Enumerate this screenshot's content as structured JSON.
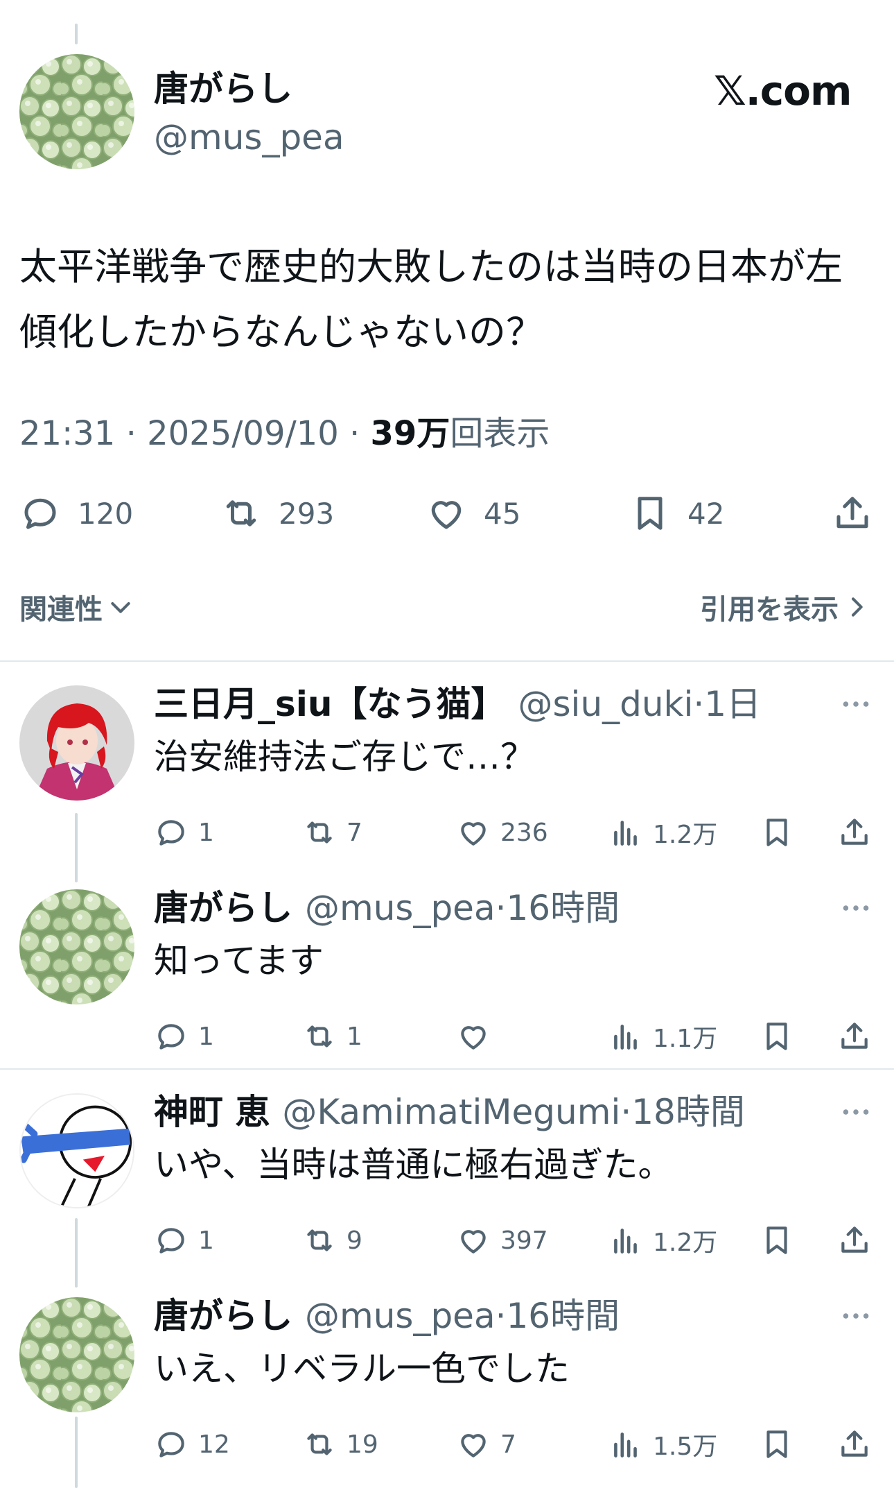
{
  "main": {
    "name": "唐がらし",
    "handle": "@mus_pea",
    "logo": "𝕏.com",
    "text": "太平洋戦争で歴史的大敗したのは当時の日本が左傾化したからなんじゃないの？",
    "time": "21:31 · 2025/09/10 · ",
    "views_num": "39万",
    "views_label": "回表示",
    "replies": "120",
    "retweets": "293",
    "likes": "45",
    "bookmarks": "42",
    "related_label": "関連性",
    "quotes_label": "引用を表示"
  },
  "replies": [
    {
      "name": "三日月_siu【なう猫】",
      "handle": "@siu_duki·1日",
      "text": "治安維持法ご存じで…？",
      "replies": "1",
      "retweets": "7",
      "likes": "236",
      "views": "1.2万"
    },
    {
      "name": "唐がらし",
      "handle": "@mus_pea·16時間",
      "text": "知ってます",
      "replies": "1",
      "retweets": "1",
      "likes": "",
      "views": "1.1万"
    },
    {
      "name": "神町 恵",
      "handle": "@KamimatiMegumi·18時間",
      "text": "いや、当時は普通に極右過ぎた。",
      "replies": "1",
      "retweets": "9",
      "likes": "397",
      "views": "1.2万"
    },
    {
      "name": "唐がらし",
      "handle": "@mus_pea·16時間",
      "text": "いえ、リベラル一色でした",
      "replies": "12",
      "retweets": "19",
      "likes": "7",
      "views": "1.5万"
    }
  ],
  "colors": {
    "text": "#0f1419",
    "secondary": "#536471",
    "divider": "#e1e8ed",
    "thread": "#cfd9de"
  },
  "icons": [
    "reply-icon",
    "retweet-icon",
    "like-icon",
    "bookmark-icon",
    "share-icon",
    "views-icon",
    "more-icon",
    "chevron-down-icon",
    "chevron-right-icon"
  ]
}
